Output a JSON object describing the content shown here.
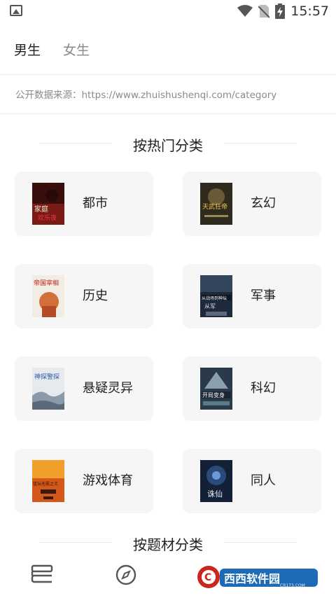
{
  "status_bar": {
    "time": "15:57",
    "icons": [
      "image-icon",
      "wifi-icon",
      "no-sim-icon",
      "battery-charging-icon"
    ]
  },
  "tabs": [
    {
      "label": "男生",
      "active": true
    },
    {
      "label": "女生",
      "active": false
    }
  ],
  "source_text": "公开数据来源：https://www.zhuishushenqi.com/category",
  "sections": {
    "hot": "按热门分类",
    "theme": "按题材分类"
  },
  "categories": [
    {
      "label": "都市",
      "cover_text": "家庭欢乐夜",
      "cover_color": "#7a1a14"
    },
    {
      "label": "玄幻",
      "cover_text": "天武狂帝",
      "cover_color": "#4a3a1c"
    },
    {
      "label": "历史",
      "cover_text": "帝国宰相",
      "cover_color": "#c8602a"
    },
    {
      "label": "军事",
      "cover_text": "从战场到神坛",
      "cover_color": "#1e2a3c"
    },
    {
      "label": "悬疑灵异",
      "cover_text": "神探警探",
      "cover_color": "#cfd6dc"
    },
    {
      "label": "科幻",
      "cover_text": "开局变身",
      "cover_color": "#2a3a4a"
    },
    {
      "label": "游戏体育",
      "cover_text": "篮坛无冕之王",
      "cover_color": "#d4581a"
    },
    {
      "label": "同人",
      "cover_text": "诛仙",
      "cover_color": "#1a2a4a"
    }
  ],
  "bottom_nav": {
    "items": [
      "bookshelf-icon",
      "compass-icon"
    ],
    "watermark": "西西软件园",
    "watermark_url": "CR173.COM"
  }
}
